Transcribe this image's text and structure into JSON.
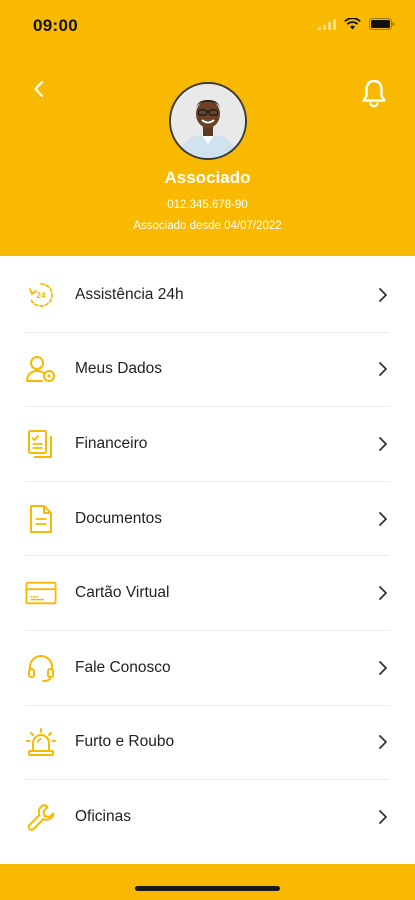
{
  "status_bar": {
    "time": "09:00"
  },
  "header": {
    "name": "Associado",
    "document": "012.345.678-90",
    "member_since": "Associado desde 04/07/2022"
  },
  "colors": {
    "accent": "#F9B900",
    "text": "#222222",
    "divider": "#ececec"
  },
  "menu": {
    "items": [
      {
        "label": "Assistência 24h",
        "icon": "assistance-24h-icon"
      },
      {
        "label": "Meus Dados",
        "icon": "user-settings-icon"
      },
      {
        "label": "Financeiro",
        "icon": "finance-documents-icon"
      },
      {
        "label": "Documentos",
        "icon": "document-icon"
      },
      {
        "label": "Cartão Virtual",
        "icon": "card-icon"
      },
      {
        "label": "Fale Conosco",
        "icon": "headset-icon"
      },
      {
        "label": "Furto e Roubo",
        "icon": "siren-icon"
      },
      {
        "label": "Oficinas",
        "icon": "wrench-icon"
      }
    ]
  }
}
